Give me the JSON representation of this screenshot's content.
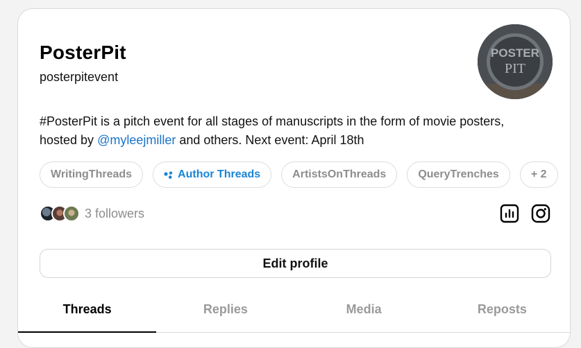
{
  "profile": {
    "name": "PosterPit",
    "handle": "posterpitevent",
    "avatar_text_top": "POSTER",
    "avatar_text_bottom": "PIT",
    "bio_before": "#PosterPit is a pitch event for all stages of manuscripts in the form of movie posters, hosted by ",
    "bio_mention": "@myleejmiller",
    "bio_after": " and others. Next event: April 18th"
  },
  "tags": [
    {
      "label": "WritingThreads"
    },
    {
      "label": "Author Threads",
      "active": true
    },
    {
      "label": "ArtistsOnThreads"
    },
    {
      "label": "QueryTrenches"
    },
    {
      "label": "+ 2"
    }
  ],
  "followers": {
    "text": "3 followers"
  },
  "icons": {
    "insights": "bar-chart-icon",
    "instagram": "instagram-icon"
  },
  "edit_button": "Edit profile",
  "tabs": [
    {
      "label": "Threads",
      "active": true
    },
    {
      "label": "Replies"
    },
    {
      "label": "Media"
    },
    {
      "label": "Reposts"
    }
  ],
  "colors": {
    "accent": "#1a85d6",
    "muted": "#8d8d8d"
  }
}
